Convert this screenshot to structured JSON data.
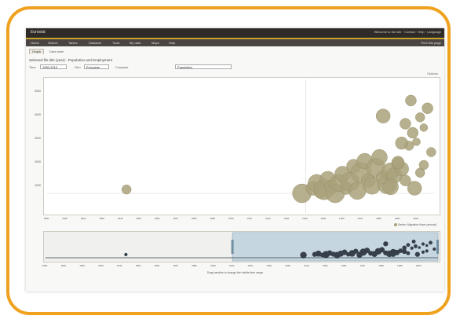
{
  "app": {
    "brand": "Eurostat",
    "user_area": "Welcome to the site · Contact · Help · Language"
  },
  "menu": {
    "items": [
      "Home",
      "Search",
      "Tables",
      "Datasets",
      "Tools",
      "My data",
      "Maps",
      "Help"
    ],
    "help_label": "Print this page"
  },
  "tabs": [
    "Graph",
    "Data table"
  ],
  "breadcrumb": "Selected file title (year) - Population and Employment",
  "filters": {
    "f1_label": "Time",
    "f1_value": "1950-2010",
    "f2_label": "Geo",
    "f2_value": "European",
    "f3_label": "Compare",
    "f3_value": "Population"
  },
  "hint": "Options",
  "colors": {
    "bubble": "#a9a27b",
    "bubble_dark": "#5e5a45",
    "timeline_band": "#c6d6e0",
    "timeline_fill": "#37404a"
  },
  "chart_data": {
    "type": "scatter",
    "x": [
      1843,
      1938,
      1944,
      1946,
      1948,
      1950,
      1952,
      1954,
      1956,
      1958,
      1960,
      1962,
      1964,
      1966,
      1968,
      1970,
      1972,
      1974,
      1976,
      1978,
      1980,
      1982,
      1984,
      1986,
      1988,
      1990,
      1992,
      1994,
      1996,
      1998,
      2000,
      2002,
      2004,
      2006,
      2008,
      1982,
      1990,
      1997,
      2002,
      1986,
      1994,
      2004,
      1992,
      1999
    ],
    "y": [
      850,
      700,
      900,
      1100,
      750,
      850,
      1250,
      950,
      700,
      1100,
      1450,
      900,
      1150,
      1750,
      800,
      1500,
      1950,
      1200,
      1000,
      1700,
      2100,
      1300,
      1050,
      1550,
      1400,
      1850,
      1650,
      1200,
      2550,
      3050,
      2700,
      3650,
      3250,
      4000,
      2300,
      3700,
      1900,
      4300,
      1500,
      950,
      3400,
      1800,
      2650,
      900
    ],
    "r": [
      6,
      12,
      9,
      11,
      8,
      13,
      10,
      9,
      12,
      11,
      10,
      8,
      12,
      9,
      11,
      13,
      10,
      9,
      11,
      12,
      10,
      9,
      12,
      11,
      10,
      8,
      9,
      7,
      6,
      7,
      5,
      6,
      5,
      7,
      6,
      9,
      8,
      7,
      6,
      10,
      7,
      6,
      8,
      9
    ],
    "xlim": [
      1800,
      2010
    ],
    "ylim": [
      0,
      5000
    ],
    "xticks": [
      "1800",
      "1810",
      "1820",
      "1830",
      "1840",
      "1850",
      "1860",
      "1870",
      "1880",
      "1890",
      "1900",
      "1910",
      "1920",
      "1930",
      "1940",
      "1950",
      "1960",
      "1970",
      "1980",
      "1990",
      "2000"
    ],
    "yticks": [
      "1000",
      "2000",
      "3000",
      "4000",
      "5000"
    ],
    "legend": "Series: Migration flows (annual)",
    "timeline_caption": "Drag handles to change the visible time range",
    "timeline_selection": [
      1900,
      2010
    ]
  }
}
